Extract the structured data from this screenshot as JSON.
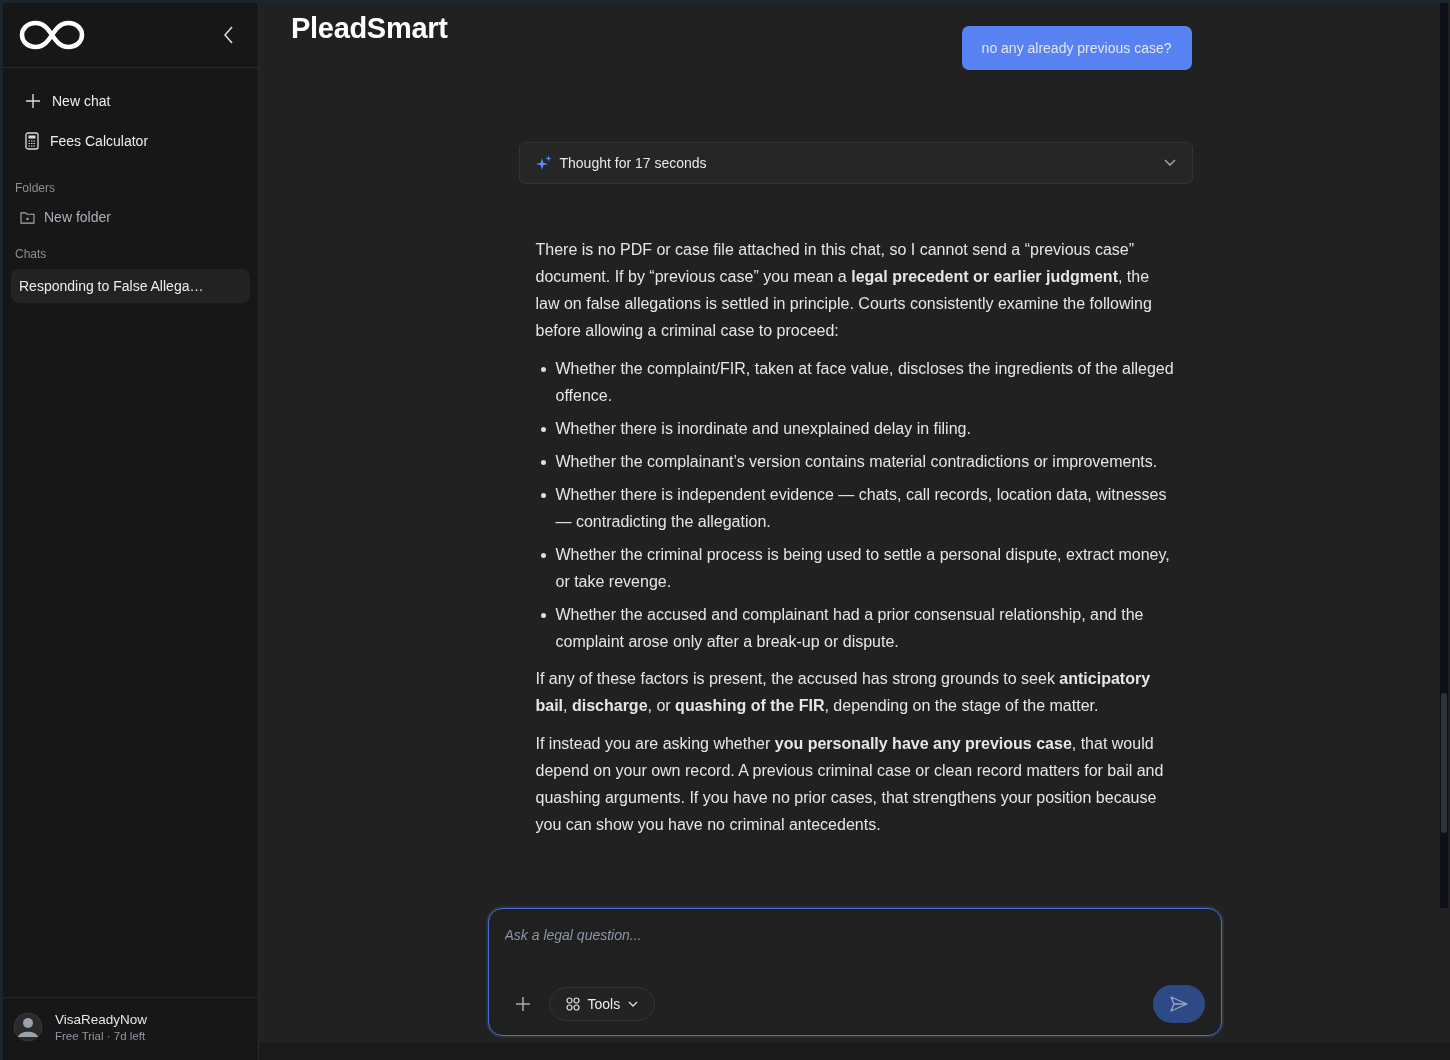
{
  "sidebar": {
    "actions": [
      {
        "kind": "new",
        "label": "New chat"
      },
      {
        "kind": "calculator",
        "label": "Fees Calculator"
      }
    ],
    "folders": {
      "heading": "Folders",
      "items": [
        {
          "label": "New folder"
        }
      ]
    },
    "chats": {
      "heading": "Chats",
      "items": [
        {
          "label": "Responding to False Allega…",
          "selected": true
        }
      ]
    },
    "user": {
      "name": "VisaReadyNow",
      "plan": "Free Trial · 7d left"
    }
  },
  "header": {
    "title": "PleadSmart"
  },
  "conversation": {
    "user_message": "no any already previous case?",
    "thought": {
      "label": "Thought for 17 seconds",
      "expanded": false
    },
    "answer": [
      {
        "kind": "paragraph",
        "text": "There is no PDF or case file attached in this chat, so I cannot send a “previous case” document. If by “previous case” you mean a **legal precedent or earlier judgment**, the law on false allegations is settled in principle. Courts consistently examine the following before allowing a criminal case to proceed:"
      },
      {
        "kind": "list",
        "items": [
          "Whether the complaint/FIR, taken at face value, discloses the ingredients of the alleged offence.",
          "Whether there is inordinate and unexplained delay in filing.",
          "Whether the complainant’s version contains material contradictions or improvements.",
          "Whether there is independent evidence — chats, call records, location data, witnesses — contradicting the allegation.",
          "Whether the criminal process is being used to settle a personal dispute, extract money, or take revenge.",
          "Whether the accused and complainant had a prior consensual relationship, and the complaint arose only after a break-up or dispute."
        ]
      },
      {
        "kind": "paragraph",
        "text": "If any of these factors is present, the accused has strong grounds to seek **anticipatory bail**, **discharge**, or **quashing of the FIR**, depending on the stage of the matter."
      },
      {
        "kind": "paragraph",
        "text": "If instead you are asking whether **you personally have any previous case**, that would depend on your own record. A previous criminal case or clean record matters for bail and quashing arguments. If you have no prior cases, that strengthens your position because you can show you have no criminal antecedents."
      }
    ]
  },
  "composer": {
    "placeholder": "Ask a legal question...",
    "tools_label": "Tools"
  }
}
